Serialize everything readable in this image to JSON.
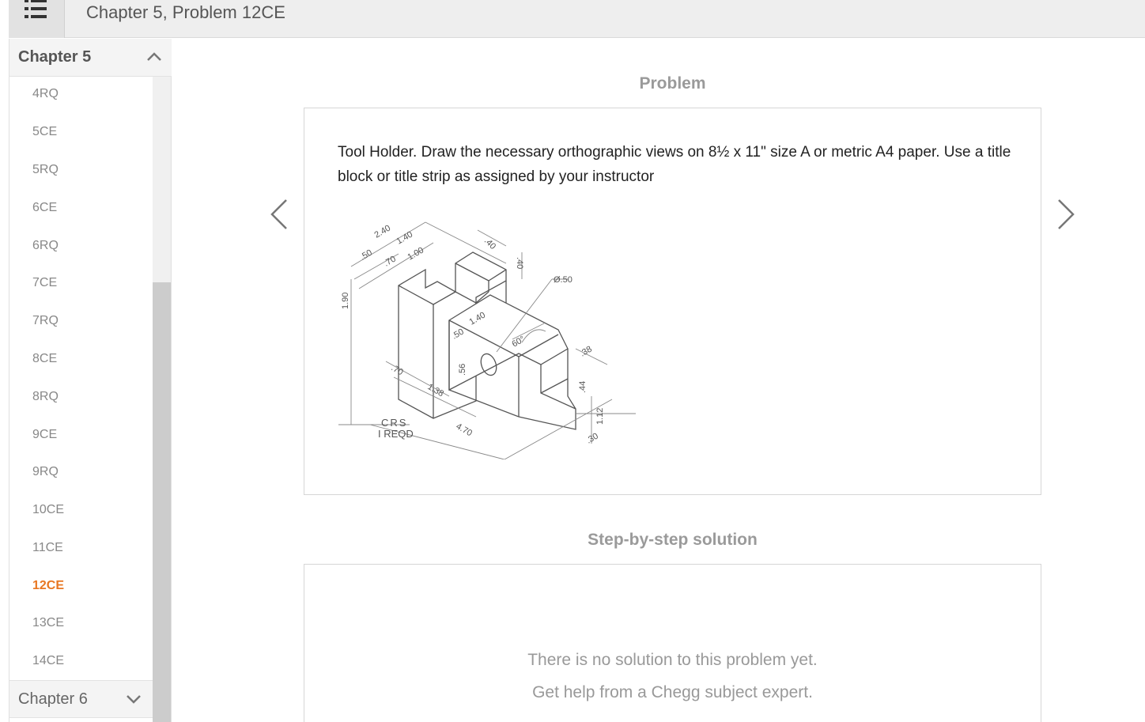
{
  "header": {
    "menu_icon": "list-menu-icon",
    "title": "Chapter 5, Problem 12CE"
  },
  "sidebar": {
    "current_chapter": "Chapter 5",
    "next_chapter": "Chapter 6",
    "items": [
      "4RQ",
      "5CE",
      "5RQ",
      "6CE",
      "6RQ",
      "7CE",
      "7RQ",
      "8CE",
      "8RQ",
      "9CE",
      "9RQ",
      "10CE",
      "11CE",
      "12CE",
      "13CE",
      "14CE"
    ],
    "active_item": "12CE"
  },
  "problem": {
    "heading": "Problem",
    "text": "Tool Holder. Draw the necessary orthographic views on 8½ x 11\" size A or metric A4 paper. Use a title block or title strip as assigned by your instructor",
    "figure": {
      "dims": [
        "2.40",
        ".50",
        "1.40",
        ".70",
        "1.00",
        ".40",
        ".40",
        "1.90",
        "Ø.50",
        ".50",
        "1.40",
        "60°",
        ".56",
        ".38",
        ".70",
        "1.38",
        ".44",
        "1.12",
        ".30",
        "4.70"
      ],
      "material": "CRS",
      "quantity": "I REQD"
    }
  },
  "solution": {
    "heading": "Step-by-step solution",
    "line1": "There is no solution to this problem yet.",
    "line2": "Get help from a Chegg subject expert."
  },
  "colors": {
    "active": "#e87722",
    "heading": "#9a9a9a",
    "header_bg": "#eeeeee"
  }
}
